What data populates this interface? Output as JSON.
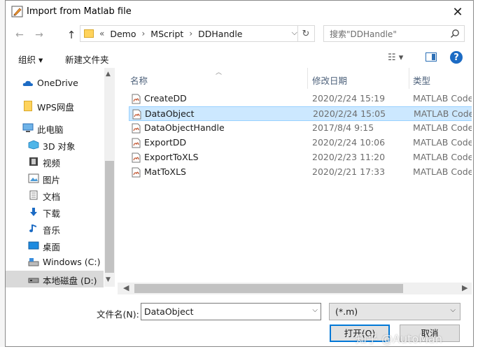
{
  "window": {
    "title": "Import from Matlab file",
    "close_glyph": "✕"
  },
  "nav": {
    "back_glyph": "←",
    "forward_glyph": "→",
    "up_glyph": "↑",
    "breadcrumb": [
      "Demo",
      "MScript",
      "DDHandle"
    ],
    "overflow_glyph": "«",
    "search_placeholder": "搜索\"DDHandle\""
  },
  "toolbar": {
    "organize_label": "组织 ▾",
    "new_folder_label": "新建文件夹",
    "view_glyph": "☷ ▾",
    "help_label": "?"
  },
  "sidebar": {
    "items": [
      {
        "label": "OneDrive",
        "icon": "cloud-icon"
      },
      {
        "label": "WPS网盘",
        "icon": "folder-icon"
      },
      {
        "label": "此电脑",
        "icon": "computer-icon"
      },
      {
        "label": "3D 对象",
        "icon": "cube-icon"
      },
      {
        "label": "视频",
        "icon": "video-icon"
      },
      {
        "label": "图片",
        "icon": "picture-icon"
      },
      {
        "label": "文档",
        "icon": "document-icon"
      },
      {
        "label": "下载",
        "icon": "download-icon"
      },
      {
        "label": "音乐",
        "icon": "music-icon"
      },
      {
        "label": "桌面",
        "icon": "desktop-icon"
      },
      {
        "label": "Windows (C:)",
        "icon": "drive-icon"
      },
      {
        "label": "本地磁盘 (D:)",
        "icon": "drive-icon",
        "selected": true
      }
    ]
  },
  "files": {
    "columns": {
      "name": "名称",
      "date": "修改日期",
      "type": "类型"
    },
    "rows": [
      {
        "name": "CreateDD",
        "date": "2020/2/24 15:19",
        "type": "MATLAB Code"
      },
      {
        "name": "DataObject",
        "date": "2020/2/24 15:05",
        "type": "MATLAB Code",
        "selected": true
      },
      {
        "name": "DataObjectHandle",
        "date": "2017/8/4 9:15",
        "type": "MATLAB Code"
      },
      {
        "name": "ExportDD",
        "date": "2020/2/24 10:06",
        "type": "MATLAB Code"
      },
      {
        "name": "ExportToXLS",
        "date": "2020/2/23 11:20",
        "type": "MATLAB Code"
      },
      {
        "name": "MatToXLS",
        "date": "2020/2/21 17:33",
        "type": "MATLAB Code"
      }
    ]
  },
  "footer": {
    "filename_label": "文件名(N):",
    "filename_value": "DataObject",
    "filter_value": "(*.m)",
    "open_label": "打开(O)",
    "cancel_label": "取消"
  },
  "watermark": "知乎 @AutoMan",
  "colors": {
    "accent": "#0078d7",
    "selection": "#cce8ff"
  }
}
